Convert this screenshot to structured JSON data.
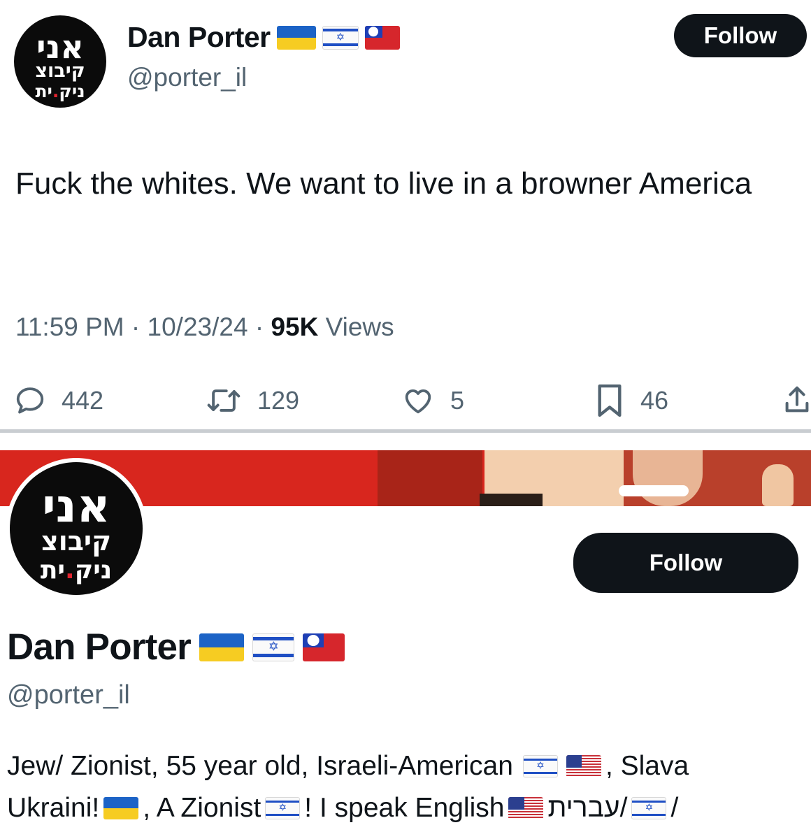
{
  "tweet": {
    "avatar_text": {
      "line1": "אני",
      "line2": "קיבוצ",
      "line3_a": "ניק",
      "line3_dot": ".",
      "line3_b": "ית"
    },
    "display_name": "Dan Porter",
    "name_flags": [
      "ukraine-flag",
      "israel-flag",
      "taiwan-flag"
    ],
    "handle": "@porter_il",
    "follow_label": "Follow",
    "text": "Fuck the whites. We want to live in a browner America",
    "meta": {
      "time": "11:59 PM",
      "sep1": " · ",
      "date": "10/23/24",
      "sep2": " · ",
      "views_count": "95K",
      "views_label": " Views"
    },
    "actions": {
      "replies": "442",
      "reposts": "129",
      "likes": "5",
      "bookmarks": "46"
    },
    "icons": {
      "reply": "speech-bubble-icon",
      "repost": "repost-icon",
      "like": "heart-icon",
      "bookmark": "bookmark-icon",
      "share": "share-icon"
    }
  },
  "profile": {
    "avatar_text": {
      "line1": "אני",
      "line2": "קיבוצ",
      "line3_a": "ניק",
      "line3_dot": ".",
      "line3_b": "ית"
    },
    "follow_label": "Follow",
    "display_name": "Dan Porter",
    "handle": "@porter_il",
    "bio": {
      "line1_a": "Jew/ Zionist, 55 year old, Israeli-American",
      "line1_b": ", Slava",
      "line2_a": "Ukraini!",
      "line2_b": ", A Zionist",
      "line2_c": "! I speak English",
      "line2_d": "/עברית",
      "line2_e": "/",
      "line3_partial": "..."
    }
  },
  "colors": {
    "text_primary": "#0f1419",
    "text_secondary": "#536471",
    "button_bg": "#0f1419",
    "banner_red": "#d8261e",
    "avatar_bg": "#0b0b0b",
    "avatar_dot": "#e0242f"
  }
}
